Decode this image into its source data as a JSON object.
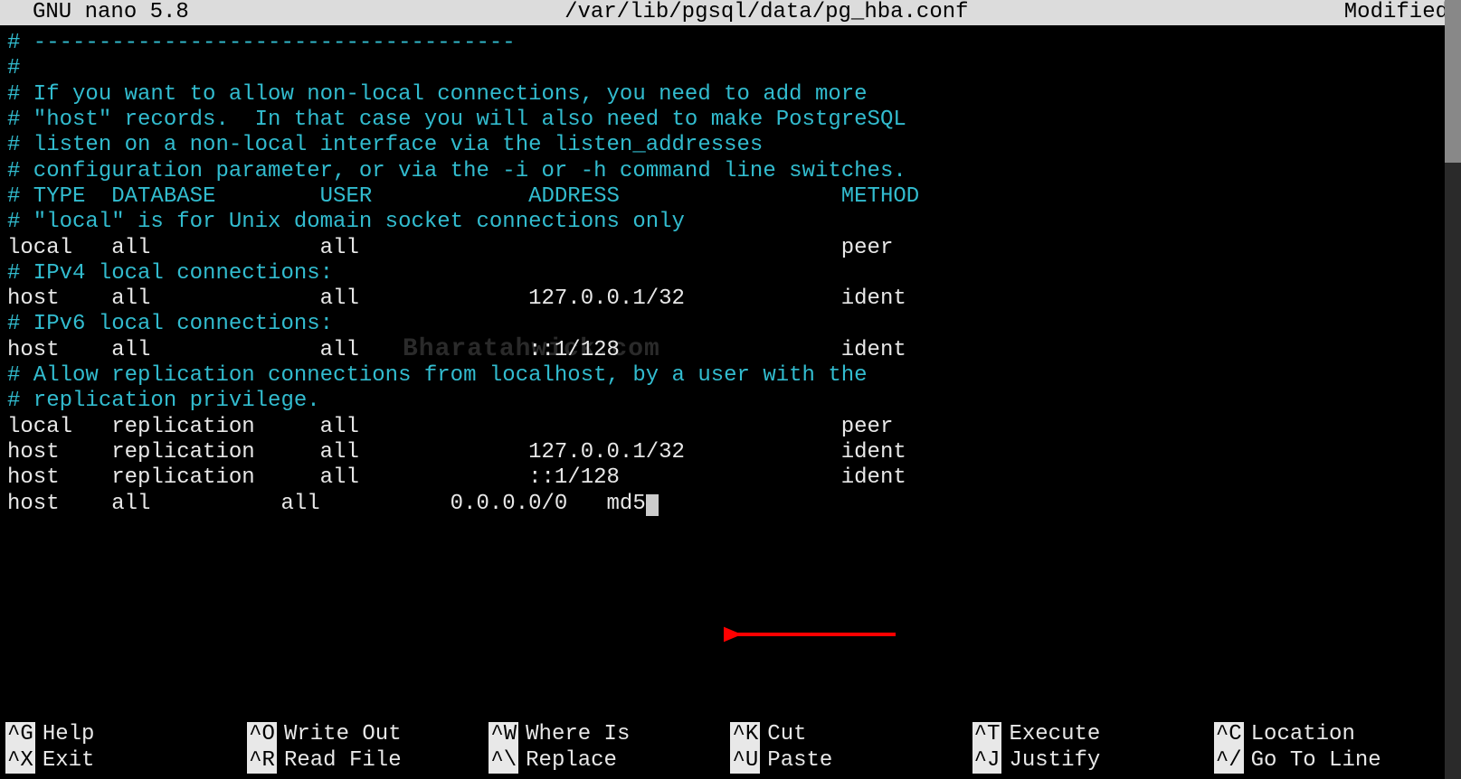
{
  "titlebar": {
    "app": "  GNU nano 5.8",
    "filepath": "/var/lib/pgsql/data/pg_hba.conf",
    "status": "Modified"
  },
  "watermark": "Bharatahwick.com",
  "lines": [
    {
      "cls": "comment",
      "text": "# -------------------------------------"
    },
    {
      "cls": "comment",
      "text": "#"
    },
    {
      "cls": "comment",
      "text": "# If you want to allow non-local connections, you need to add more"
    },
    {
      "cls": "comment",
      "text": "# \"host\" records.  In that case you will also need to make PostgreSQL"
    },
    {
      "cls": "comment",
      "text": "# listen on a non-local interface via the listen_addresses"
    },
    {
      "cls": "comment",
      "text": "# configuration parameter, or via the -i or -h command line switches."
    },
    {
      "cls": "plain",
      "text": ""
    },
    {
      "cls": "plain",
      "text": ""
    },
    {
      "cls": "plain",
      "text": ""
    },
    {
      "cls": "comment",
      "text": "# TYPE  DATABASE        USER            ADDRESS                 METHOD"
    },
    {
      "cls": "plain",
      "text": ""
    },
    {
      "cls": "comment",
      "text": "# \"local\" is for Unix domain socket connections only"
    },
    {
      "cls": "plain",
      "text": "local   all             all                                     peer"
    },
    {
      "cls": "comment",
      "text": "# IPv4 local connections:"
    },
    {
      "cls": "plain",
      "text": "host    all             all             127.0.0.1/32            ident"
    },
    {
      "cls": "comment",
      "text": "# IPv6 local connections:"
    },
    {
      "cls": "plain",
      "text": "host    all             all             ::1/128                 ident"
    },
    {
      "cls": "comment",
      "text": "# Allow replication connections from localhost, by a user with the"
    },
    {
      "cls": "comment",
      "text": "# replication privilege."
    },
    {
      "cls": "plain",
      "text": "local   replication     all                                     peer"
    },
    {
      "cls": "plain",
      "text": "host    replication     all             127.0.0.1/32            ident"
    },
    {
      "cls": "plain",
      "text": "host    replication     all             ::1/128                 ident"
    },
    {
      "cls": "plain",
      "text": "host    all          all          0.0.0.0/0   md5",
      "cursor": true
    }
  ],
  "shortcuts": [
    {
      "key": "^G",
      "label": "Help"
    },
    {
      "key": "^O",
      "label": "Write Out"
    },
    {
      "key": "^W",
      "label": "Where Is"
    },
    {
      "key": "^K",
      "label": "Cut"
    },
    {
      "key": "^T",
      "label": "Execute"
    },
    {
      "key": "^C",
      "label": "Location"
    },
    {
      "key": "^X",
      "label": "Exit"
    },
    {
      "key": "^R",
      "label": "Read File"
    },
    {
      "key": "^\\",
      "label": "Replace"
    },
    {
      "key": "^U",
      "label": "Paste"
    },
    {
      "key": "^J",
      "label": "Justify"
    },
    {
      "key": "^/",
      "label": "Go To Line"
    }
  ]
}
